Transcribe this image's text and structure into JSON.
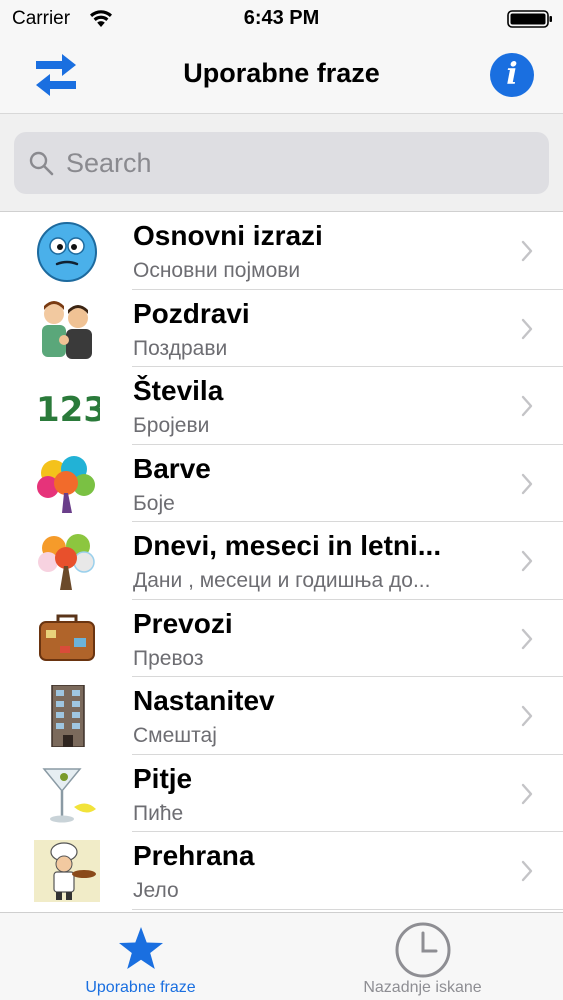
{
  "status_bar": {
    "carrier": "Carrier",
    "time": "6:43 PM"
  },
  "nav": {
    "title": "Uporabne fraze",
    "info_glyph": "i",
    "accent": "#1a6fe0"
  },
  "search": {
    "placeholder": "Search"
  },
  "categories": [
    {
      "title": "Osnovni izrazi",
      "subtitle": "Основни појмови",
      "icon": "smiley-face-icon"
    },
    {
      "title": "Pozdravi",
      "subtitle": "Поздрави",
      "icon": "greeting-people-icon"
    },
    {
      "title": "Števila",
      "subtitle": "Бројеви",
      "icon": "numbers-123-icon",
      "icon_text": "123"
    },
    {
      "title": "Barve",
      "subtitle": "Боје",
      "icon": "colorful-tree-icon"
    },
    {
      "title": "Dnevi, meseci in letni...",
      "subtitle": "Дани , месеци и годишња до...",
      "icon": "seasons-tree-icon"
    },
    {
      "title": "Prevozi",
      "subtitle": "Превоз",
      "icon": "suitcase-icon"
    },
    {
      "title": "Nastanitev",
      "subtitle": "Смештај",
      "icon": "hotel-building-icon"
    },
    {
      "title": "Pitje",
      "subtitle": "Пиће",
      "icon": "cocktail-glass-icon"
    },
    {
      "title": "Prehrana",
      "subtitle": "Јело",
      "icon": "chef-icon"
    }
  ],
  "tabs": [
    {
      "label": "Uporabne fraze",
      "icon": "star-icon",
      "selected": true
    },
    {
      "label": "Nazadnje iskane",
      "icon": "clock-icon",
      "selected": false
    }
  ]
}
